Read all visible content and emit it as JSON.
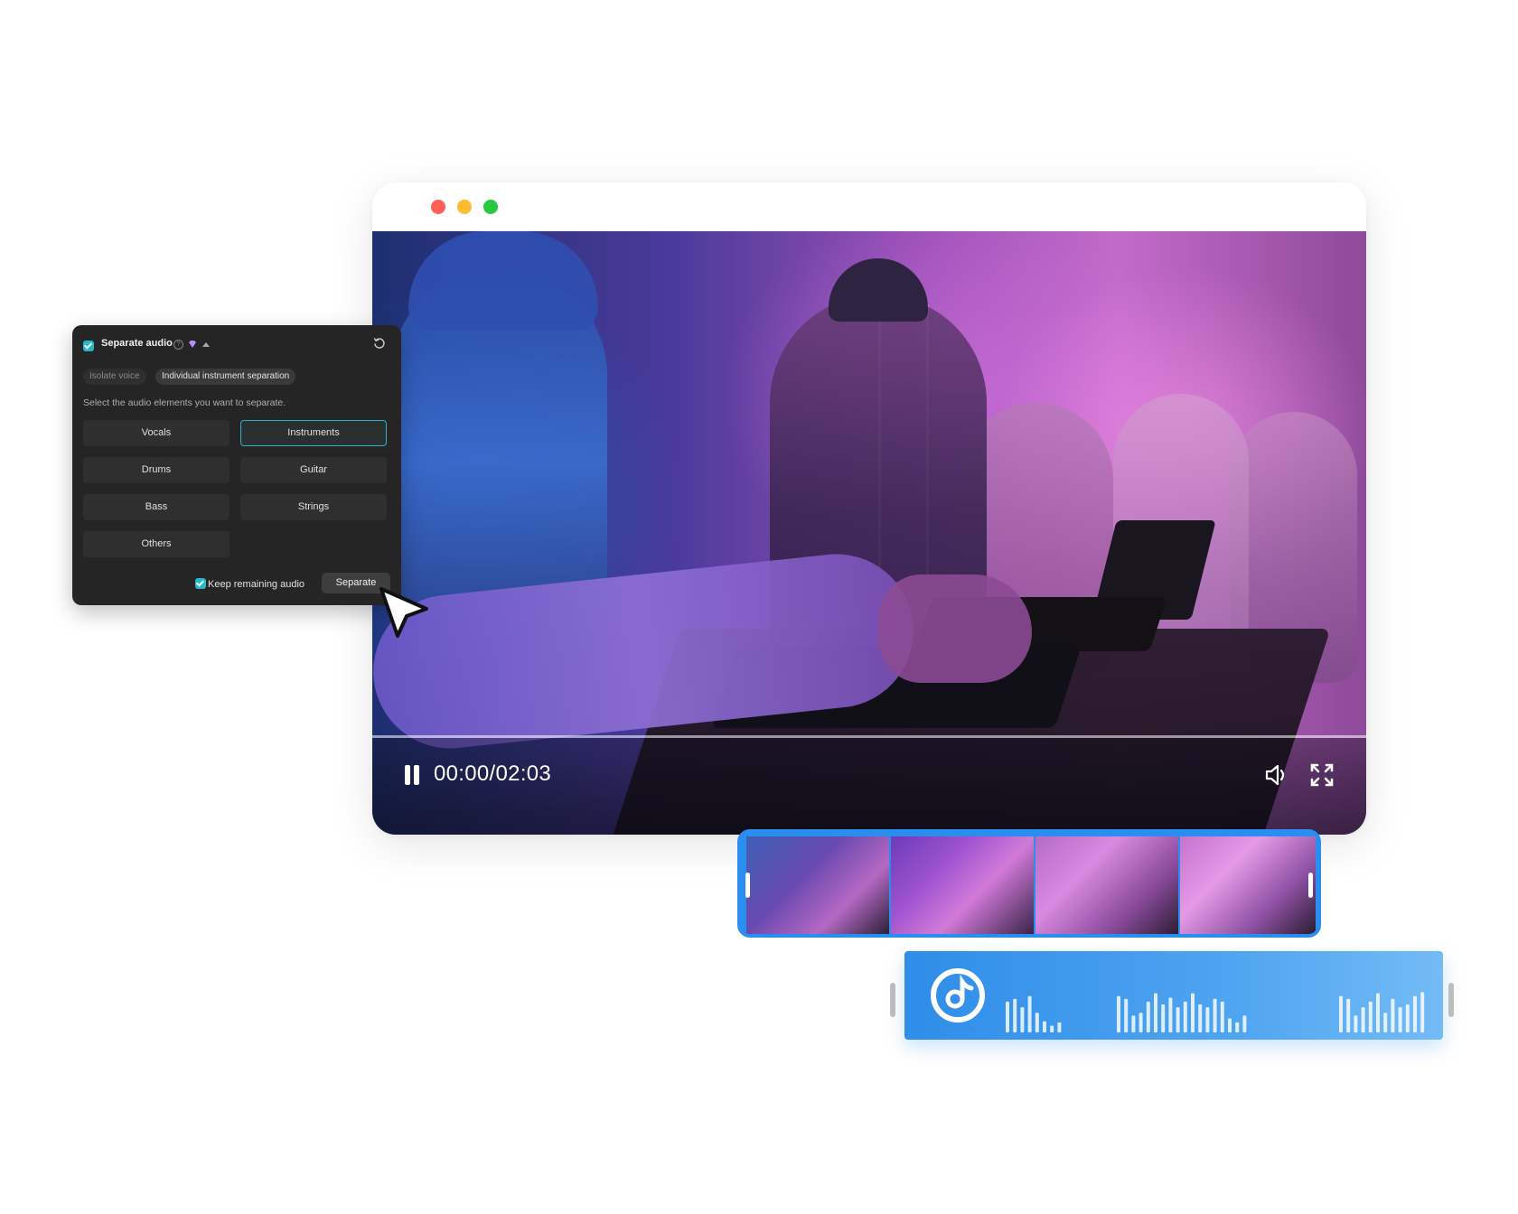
{
  "window": {
    "traffic_lights": {
      "close": "#fe5f57",
      "minimize": "#febc2e",
      "maximize": "#28c840"
    }
  },
  "player": {
    "timecode": "00:00/02:03",
    "icons": {
      "play": "pause-icon",
      "volume": "volume-icon",
      "fullscreen": "fullscreen-icon"
    }
  },
  "panel": {
    "title": "Separate audio",
    "info": "?",
    "tabs": {
      "inactive": "Isolate voice",
      "active": "Individual instrument separation"
    },
    "hint": "Select the audio elements you want to separate.",
    "options": [
      {
        "label": "Vocals",
        "selected": false
      },
      {
        "label": "Instruments",
        "selected": true
      },
      {
        "label": "Drums",
        "selected": false
      },
      {
        "label": "Guitar",
        "selected": false
      },
      {
        "label": "Bass",
        "selected": false
      },
      {
        "label": "Strings",
        "selected": false
      },
      {
        "label": "Others",
        "selected": false
      }
    ],
    "keep_remaining_label": "Keep remaining audio",
    "keep_remaining_checked": true,
    "separate_button": "Separate",
    "accent": "#26b5c9"
  },
  "timeline": {
    "clip_border_color": "#2a8df0",
    "audio_track_color": "#2f8de8",
    "waveform_levels": [
      0.55,
      0.6,
      0.45,
      0.65,
      0.35,
      0.2,
      0.12,
      0.18,
      0,
      0,
      0,
      0,
      0,
      0,
      0,
      0.65,
      0.6,
      0.3,
      0.35,
      0.55,
      0.7,
      0.5,
      0.62,
      0.45,
      0.55,
      0.7,
      0.5,
      0.45,
      0.6,
      0.55,
      0.25,
      0.18,
      0.3,
      0,
      0,
      0,
      0,
      0,
      0,
      0,
      0,
      0,
      0,
      0,
      0,
      0.65,
      0.6,
      0.3,
      0.45,
      0.55,
      0.7,
      0.35,
      0.6,
      0.45,
      0.5,
      0.65,
      0.72
    ]
  }
}
